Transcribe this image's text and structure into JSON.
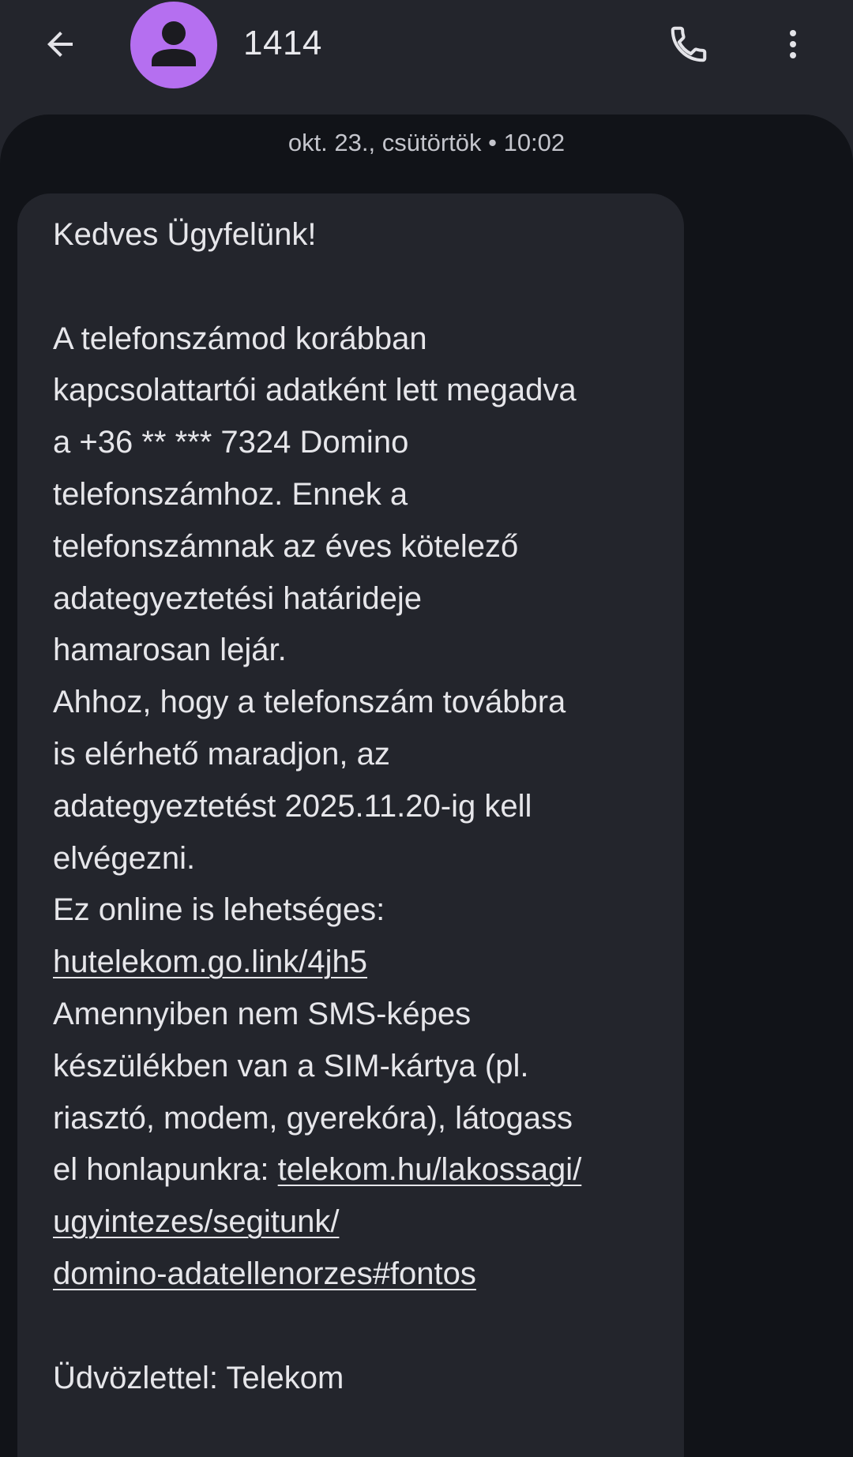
{
  "app_bar": {
    "back_icon": "arrow-left-icon",
    "contact_name": "1414",
    "avatar_icon": "person-icon",
    "avatar_color": "#b56ff0",
    "call_icon": "phone-icon",
    "more_icon": "more-vert-icon"
  },
  "conversation": {
    "timestamp": "okt. 23., csütörtök • 10:02",
    "message": {
      "greeting": "Kedves Ügyfelünk!",
      "p1_l1": "A telefonszámod korábban",
      "p1_l2": "kapcsolattartói adatként lett megadva",
      "p1_l3": "a +36 ** *** 7324 Domino",
      "p1_l4": "telefonszámhoz. Ennek a",
      "p1_l5": "telefonszámnak az éves kötelező",
      "p1_l6": "adategyeztetési határideje",
      "p1_l7": "hamarosan lejár.",
      "p2_l1": "Ahhoz, hogy a telefonszám továbbra",
      "p2_l2": "is elérhető maradjon, az",
      "p2_l3": "adategyeztetést 2025.11.20-ig kell",
      "p2_l4": "elvégezni.",
      "p3_l1": "Ez online is lehetséges:",
      "link1": "hutelekom.go.link/4jh5",
      "p4_l1": "Amennyiben nem SMS-képes",
      "p4_l2": "készülékben van a SIM-kártya (pl.",
      "p4_l3": "riasztó, modem, gyerekóra), látogass",
      "p4_l4_prefix": "el honlapunkra: ",
      "link2_l1": "telekom.hu/lakossagi/",
      "link2_l2": "ugyintezes/segitunk/",
      "link2_l3": "domino-adatellenorzes#fontos",
      "signoff": "Üdvözlettel: Telekom"
    }
  }
}
